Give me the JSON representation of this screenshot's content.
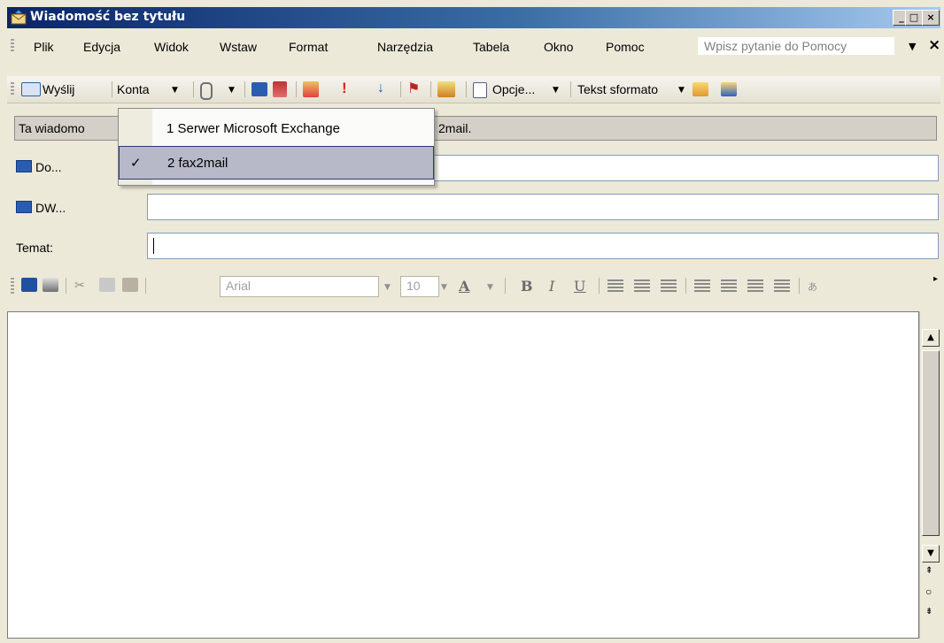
{
  "window": {
    "title": "Wiadomość bez tytułu",
    "controls": {
      "minimize": "_",
      "maximize": "□",
      "close": "×"
    }
  },
  "menu": {
    "items": [
      "Plik",
      "Edycja",
      "Widok",
      "Wstaw",
      "Format",
      "Narzędzia",
      "Tabela",
      "Okno",
      "Pomoc"
    ],
    "help_placeholder": "Wpisz pytanie do Pomocy",
    "close": "×"
  },
  "toolbar": {
    "send_label": "Wyślij",
    "accounts_label": "Konta",
    "options_label": "Opcje...",
    "format_label": "Tekst sformato"
  },
  "infobar": {
    "text_start": "Ta wiadomo",
    "text_end": "2mail."
  },
  "accounts_menu": {
    "items": [
      {
        "label": "1 Serwer Microsoft Exchange",
        "checked": false
      },
      {
        "label": "2 fax2mail",
        "checked": true
      }
    ],
    "check": "✓"
  },
  "fields": {
    "to_label": "Do...",
    "cc_label": "DW...",
    "subject_label": "Temat:"
  },
  "format_toolbar": {
    "font": "Arial",
    "size": "10",
    "bold": "B",
    "italic": "I",
    "underline": "U",
    "font_color": "A"
  },
  "scrollbar": {
    "up": "▲",
    "down": "▼"
  }
}
